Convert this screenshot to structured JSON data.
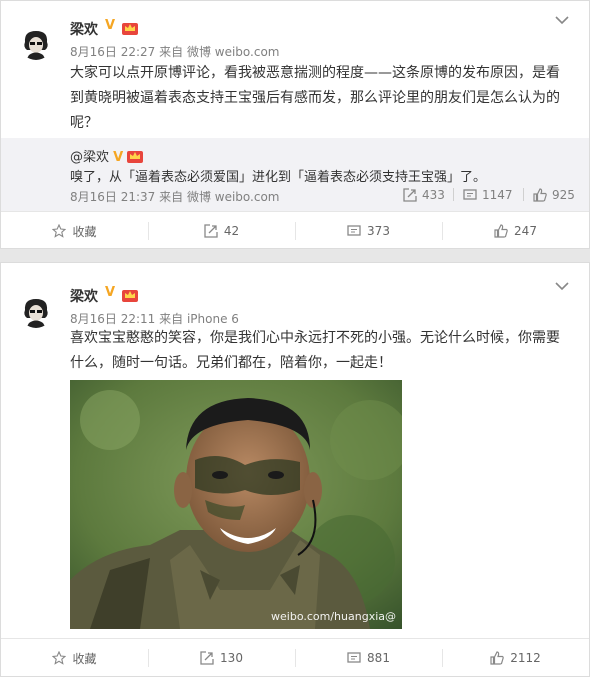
{
  "posts": [
    {
      "user": "梁欢",
      "verified_badge": "V",
      "time": "8月16日 22:27",
      "source": "来自 微博 weibo.com",
      "text_lines": [
        "大家可以点开原博评论，看我被恶意揣测的程度——这条原博的发布原因，是看",
        "到黄晓明被逼着表态支持王宝强后有感而发，那么评论里的朋友们是怎么认为的",
        "呢？"
      ],
      "quote": {
        "user": "@梁欢",
        "text": "嗅了，从「逼着表态必须爱国」进化到「逼着表态必须支持王宝强」了。",
        "time": "8月16日 21:37",
        "source": "来自 微博 weibo.com",
        "reposts": "433",
        "comments": "1147",
        "likes": "925"
      },
      "actions": {
        "favorite": "收藏",
        "repost": "42",
        "comment": "373",
        "like": "247"
      }
    },
    {
      "user": "梁欢",
      "verified_badge": "V",
      "time": "8月16日 22:11",
      "source": "来自 iPhone 6",
      "text_lines": [
        "喜欢宝宝憨憨的笑容，你是我们心中永远打不死的小强。无论什么时候，你需要",
        "什么，随时一句话。兄弟们都在，陪着你，一起走！"
      ],
      "image_watermark": "weibo.com/huangxia@",
      "actions": {
        "favorite": "收藏",
        "repost": "130",
        "comment": "881",
        "like": "2112"
      }
    }
  ],
  "colors": {
    "verified": "#f5a623",
    "level_badge": "#e8453c",
    "meta": "#808080",
    "quote_bg": "#f2f2f5"
  },
  "icons": [
    "star-icon",
    "repost-icon",
    "comment-icon",
    "like-icon",
    "chevron-down-icon",
    "vip-crown-icon"
  ]
}
